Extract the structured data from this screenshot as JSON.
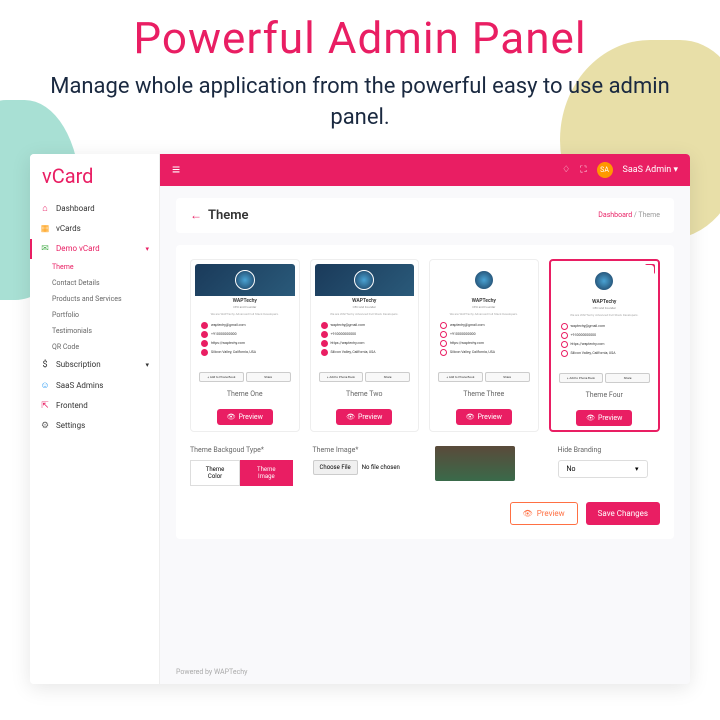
{
  "hero": {
    "title": "Powerful Admin Panel",
    "subtitle": "Manage whole application from the powerful easy to use admin panel."
  },
  "logo": "vCard",
  "sidebar": {
    "items": [
      {
        "icon": "⌂",
        "label": "Dashboard",
        "color": "#e91e63"
      },
      {
        "icon": "▦",
        "label": "vCards",
        "color": "#ff9800"
      },
      {
        "icon": "✉",
        "label": "Demo vCard",
        "color": "#4caf50",
        "active": true,
        "expand": true
      },
      {
        "icon": "$",
        "label": "Subscription",
        "color": "#333",
        "expand": true
      },
      {
        "icon": "☺",
        "label": "SaaS Admins",
        "color": "#2196f3"
      },
      {
        "icon": "⇱",
        "label": "Frontend",
        "color": "#e91e63"
      },
      {
        "icon": "⚙",
        "label": "Settings",
        "color": "#666"
      }
    ],
    "sub": [
      {
        "label": "Theme",
        "active": true
      },
      {
        "label": "Contact Details"
      },
      {
        "label": "Products and Services"
      },
      {
        "label": "Portfolio"
      },
      {
        "label": "Testimonials"
      },
      {
        "label": "QR Code"
      }
    ]
  },
  "topbar": {
    "user": "SaaS Admin",
    "initials": "SA"
  },
  "page": {
    "title": "Theme",
    "breadcrumb": {
      "root": "Dashboard",
      "current": "Theme"
    }
  },
  "themes": [
    {
      "name": "Theme One",
      "company": "WAPTechy"
    },
    {
      "name": "Theme Two",
      "company": "WAPTechy"
    },
    {
      "name": "Theme Three",
      "company": "WAPTechy"
    },
    {
      "name": "Theme Four",
      "company": "WAPTechy",
      "selected": true
    }
  ],
  "card_sample": {
    "name": "WAPTechy",
    "role": "CEO and Founder",
    "desc": "We are WAPTechy Advanced Full Stack Developers.",
    "email": "waptechy@gmail.com",
    "phone": "+910000000000",
    "web": "https://waptechy.com",
    "addr": "Silicon Valley, California, USA",
    "add_btn": "Add to Phone Book",
    "share_btn": "Share"
  },
  "preview_label": "Preview",
  "form": {
    "bg_type": {
      "label": "Theme Backgoud Type*",
      "opt1": "Theme Color",
      "opt2": "Theme Image"
    },
    "image": {
      "label": "Theme Image*",
      "choose": "Choose File",
      "none": "No file chosen"
    },
    "hide": {
      "label": "Hide Branding",
      "value": "No"
    }
  },
  "actions": {
    "preview": "Preview",
    "save": "Save Changes"
  },
  "footer": "Powered by WAPTechy"
}
